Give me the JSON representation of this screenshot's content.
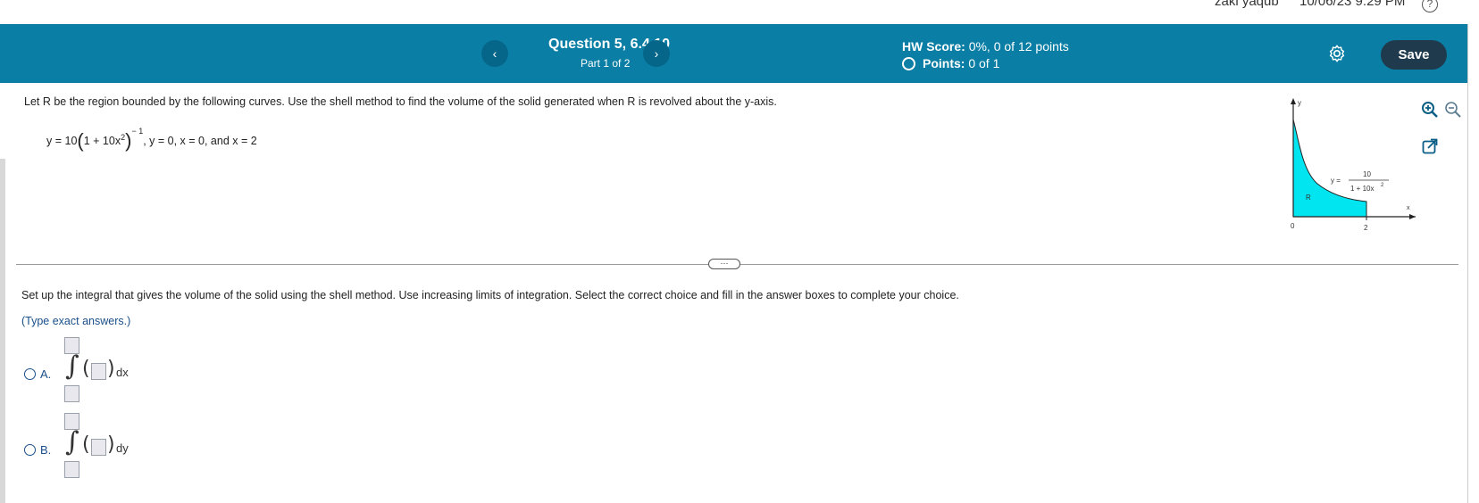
{
  "topbar": {
    "user": "zaki yaqub",
    "datetime": "10/06/23 9:29 PM",
    "help_icon": "question-icon"
  },
  "header": {
    "question_title": "Question 5, 6.4.10",
    "question_part": "Part 1 of 2",
    "hw_score_label": "HW Score:",
    "hw_score_value": "0%, 0 of 12 points",
    "points_label": "Points:",
    "points_value": "0 of 1",
    "prev_icon": "chevron-left-icon",
    "next_icon": "chevron-right-icon",
    "settings_icon": "gear-icon",
    "save_label": "Save",
    "accent": "#0a7ea4",
    "save_color": "#1f3a4d"
  },
  "question": {
    "prompt": "Let R be the region bounded by the following curves. Use the shell method to find the volume of the solid generated when R is revolved about the y-axis.",
    "eq_prefix": "y = 10",
    "eq_inner": "1 + 10x",
    "eq_inner_exp": "2",
    "eq_outer_exp": "− 1",
    "eq_rest": ", y = 0, x = 0, and x = 2"
  },
  "graph": {
    "y_axis_label": "y",
    "x_axis_label": "x",
    "origin_label": "0",
    "tick_label": "2",
    "region_label": "R",
    "func_prefix": "y =",
    "func_numerator": "10",
    "func_denominator": "1 + 10x",
    "func_denominator_exp": "2",
    "fill_color": "#00e5f0"
  },
  "tools": [
    "zoom-in-icon",
    "zoom-out-icon",
    "popout-icon"
  ],
  "divider_button": "⋯",
  "instruction": "Set up the integral that gives the volume of the solid using the shell method. Use increasing limits of integration. Select the correct choice and fill in the answer boxes to complete your choice.",
  "hint": "(Type exact answers.)",
  "choices": [
    {
      "label": "A.",
      "integral_sign": "∫",
      "open_paren": "(",
      "close_paren": ")",
      "differential": "dx"
    },
    {
      "label": "B.",
      "integral_sign": "∫",
      "open_paren": "(",
      "close_paren": ")",
      "differential": "dy"
    }
  ]
}
